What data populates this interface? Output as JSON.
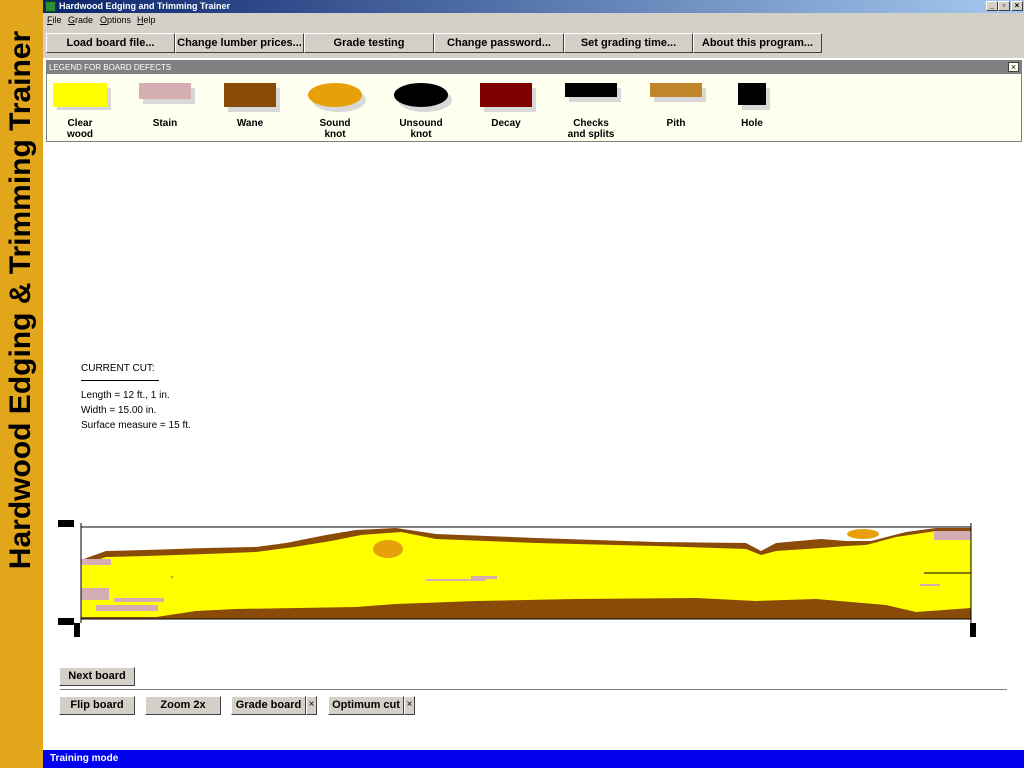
{
  "banner": {
    "text": "Hardwood Edging & Trimming Trainer"
  },
  "window": {
    "title": "Hardwood Edging and Trimming Trainer",
    "minimize": "_",
    "restore": "▫",
    "close": "×"
  },
  "menu": {
    "items": [
      {
        "label": "File"
      },
      {
        "label": "Grade"
      },
      {
        "label": "Options"
      },
      {
        "label": "Help"
      }
    ]
  },
  "toolbar": {
    "buttons": [
      {
        "label": "Load board file..."
      },
      {
        "label": "Change lumber prices..."
      },
      {
        "label": "Grade testing"
      },
      {
        "label": "Change password..."
      },
      {
        "label": "Set grading time..."
      },
      {
        "label": "About this program..."
      }
    ]
  },
  "legend": {
    "title": "LEGEND FOR BOARD DEFECTS",
    "close": "×",
    "items": [
      {
        "label": "Clear\nwood",
        "color": "#ffff00",
        "shape": "rect",
        "icon": "clear-wood-swatch"
      },
      {
        "label": "Stain",
        "color": "#d4aeb2",
        "shape": "rect",
        "icon": "stain-swatch"
      },
      {
        "label": "Wane",
        "color": "#8a4a08",
        "shape": "rect",
        "icon": "wane-swatch"
      },
      {
        "label": "Sound\nknot",
        "color": "#e8a00a",
        "shape": "ellipse",
        "icon": "sound-knot-swatch"
      },
      {
        "label": "Unsound\nknot",
        "color": "#000000",
        "shape": "ellipse",
        "icon": "unsound-knot-swatch"
      },
      {
        "label": "Decay",
        "color": "#800000",
        "shape": "rect",
        "icon": "decay-swatch"
      },
      {
        "label": "Checks\nand splits",
        "color": "#000000",
        "shape": "thin",
        "icon": "checks-swatch"
      },
      {
        "label": "Pith",
        "color": "#c0862a",
        "shape": "thin",
        "icon": "pith-swatch"
      },
      {
        "label": "Hole",
        "color": "#000000",
        "shape": "square",
        "icon": "hole-swatch"
      }
    ]
  },
  "current_cut": {
    "heading": "CURRENT CUT:",
    "length": "Length = 12 ft., 1  in.",
    "width": "Width = 15.00 in.",
    "surface": "Surface measure = 15 ft."
  },
  "actions": {
    "next_board": "Next board",
    "flip_board": "Flip board",
    "zoom": "Zoom 2x",
    "grade_board": "Grade board",
    "optimum_cut": "Optimum cut",
    "close_glyph": "×"
  },
  "status": {
    "text": "Training mode"
  }
}
